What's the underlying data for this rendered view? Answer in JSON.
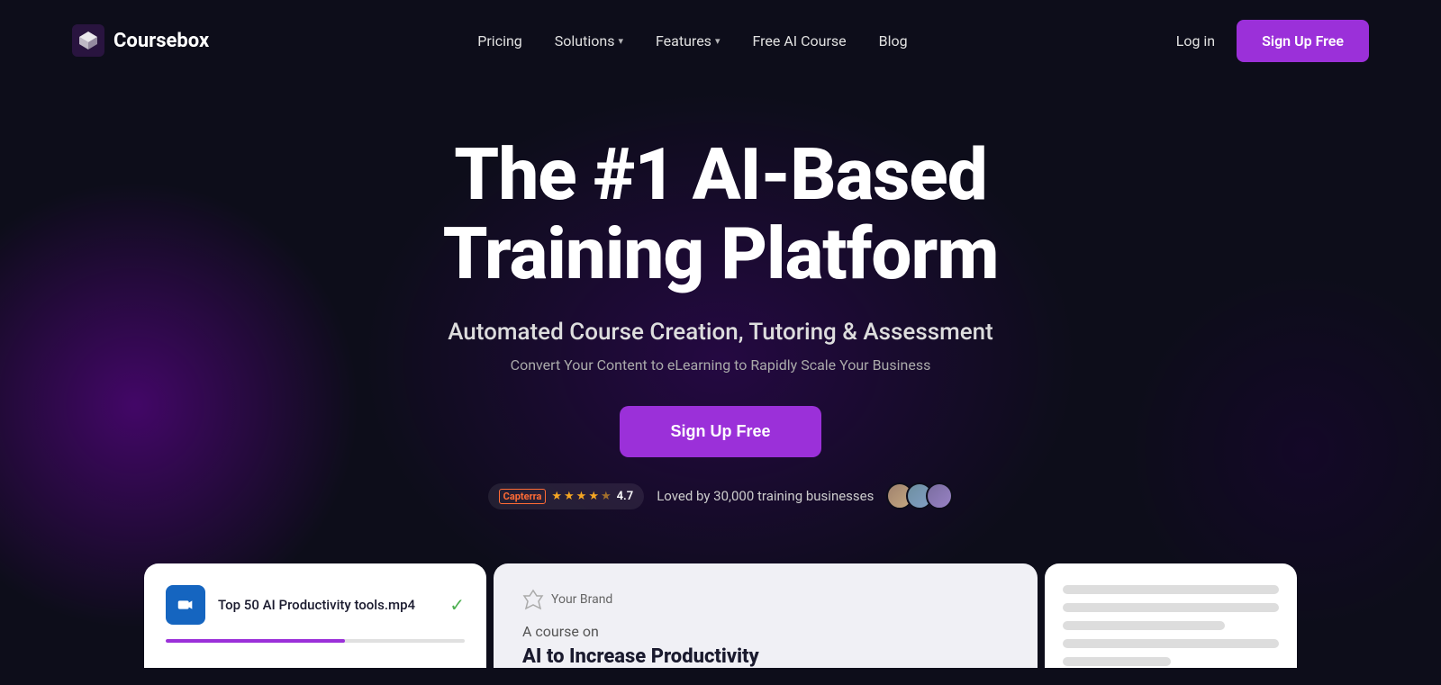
{
  "brand": {
    "name": "Coursebox",
    "logo_alt": "Coursebox logo"
  },
  "nav": {
    "links": [
      {
        "label": "Pricing",
        "has_dropdown": false
      },
      {
        "label": "Solutions",
        "has_dropdown": true
      },
      {
        "label": "Features",
        "has_dropdown": true
      },
      {
        "label": "Free AI Course",
        "has_dropdown": false
      },
      {
        "label": "Blog",
        "has_dropdown": false
      }
    ],
    "login_label": "Log in",
    "signup_label": "Sign Up Free"
  },
  "hero": {
    "title_line1": "The #1 AI-Based",
    "title_line2": "Training Platform",
    "subtitle": "Automated Course Creation, Tutoring & Assessment",
    "subtext": "Convert Your Content to eLearning to Rapidly Scale Your Business",
    "cta_label": "Sign Up Free"
  },
  "social_proof": {
    "rating": "4.7",
    "text": "Loved by 30,000 training businesses",
    "capterra_label": "Capterra"
  },
  "cards": {
    "file_name": "Top 50 AI Productivity tools.mp4",
    "brand_label": "Your Brand",
    "course_label": "A course on",
    "course_title": "AI to Increase Productivity"
  }
}
